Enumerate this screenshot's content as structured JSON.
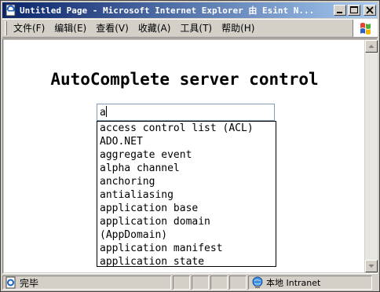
{
  "window": {
    "title": "Untitled Page - Microsoft Internet Explorer 由 Esint N...",
    "icons": {
      "app": "ie-page-icon",
      "minimize": "minimize-icon",
      "maximize": "maximize-icon",
      "close": "close-icon"
    }
  },
  "menubar": {
    "items": [
      "文件(F)",
      "编辑(E)",
      "查看(V)",
      "收藏(A)",
      "工具(T)",
      "帮助(H)"
    ],
    "logo": "windows-logo-icon"
  },
  "page": {
    "heading": "AutoComplete server control",
    "search": {
      "value": "a"
    },
    "suggestions": [
      "access control list (ACL)",
      "ADO.NET",
      "aggregate event",
      "alpha channel",
      "anchoring",
      "antialiasing",
      "application base",
      "application domain (AppDomain)",
      "application manifest",
      "application state"
    ]
  },
  "statusbar": {
    "status": "完毕",
    "zone_label": "本地 Intranet"
  },
  "colors": {
    "titlebar_start": "#0a246a",
    "titlebar_end": "#a6caf0",
    "chrome": "#d4d0c8",
    "input_border": "#7f9db9"
  }
}
